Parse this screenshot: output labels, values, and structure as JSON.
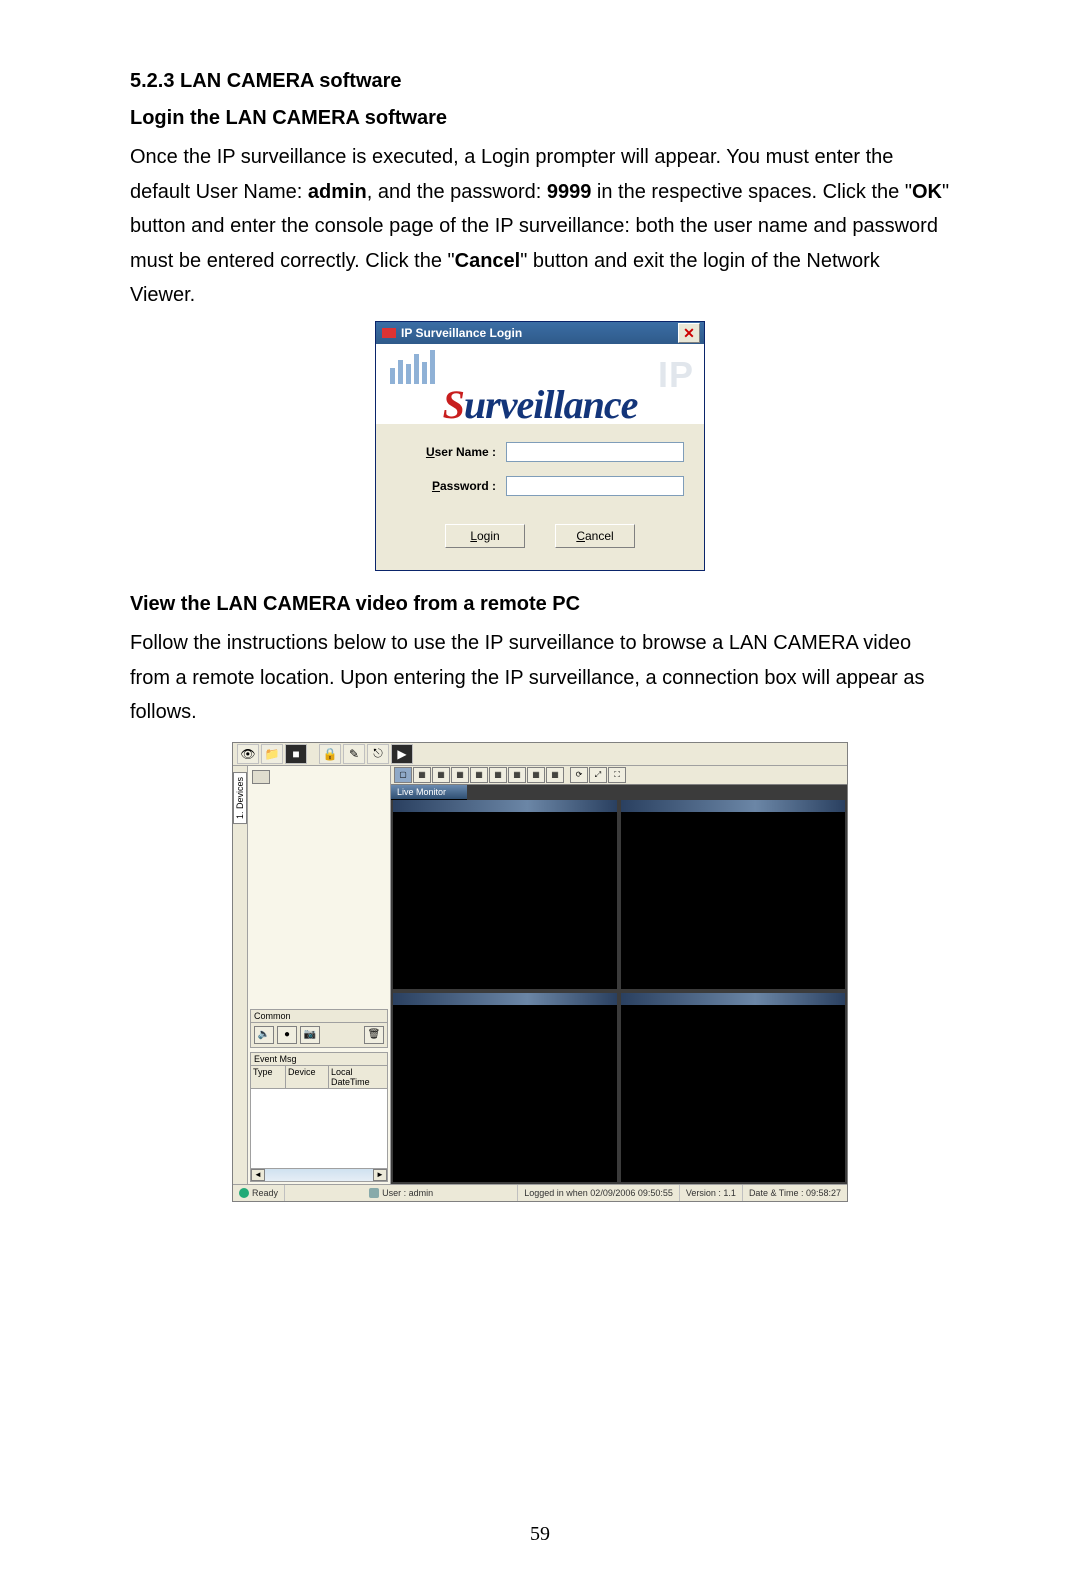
{
  "sections": {
    "heading_523": "5.2.3  LAN CAMERA software",
    "heading_login": "Login the LAN CAMERA software",
    "para1_a": "Once the IP surveillance is executed, a Login prompter will appear. You must enter the default User Name: ",
    "para1_b_bold": "admin",
    "para1_c": ", and the password: ",
    "para1_d_bold": "9999",
    "para1_e": " in the respective spaces. Click the \"",
    "para1_f_bold": "OK",
    "para1_g": "\" button and enter the console page of the IP surveillance: both the user name and password must be entered correctly. Click the \"",
    "para1_h_bold": "Cancel",
    "para1_i": "\" button and exit the login of the Network Viewer.",
    "heading_view": "View the LAN CAMERA video from a remote PC",
    "para2": "Follow the instructions below to use the IP surveillance to browse a LAN CAMERA video from a remote location. Upon entering the IP surveillance, a connection box will appear as follows."
  },
  "login_dialog": {
    "title": "IP Surveillance Login",
    "banner_red": "S",
    "banner_blue": "urveillance",
    "banner_ip": "IP",
    "user_label_ul": "U",
    "user_label_rest": "ser Name :",
    "pass_label_ul": "P",
    "pass_label_rest": "assword :",
    "login_btn_ul": "L",
    "login_btn_rest": "ogin",
    "cancel_btn_ul": "C",
    "cancel_btn_rest": "ancel"
  },
  "app": {
    "side_tab": "1. Devices",
    "common_title": "Common",
    "eventmsg_title": "Event Msg",
    "col_type": "Type",
    "col_device": "Device",
    "col_ldt": "Local DateTime",
    "live_tab": "Live Monitor",
    "status_ready": "Ready",
    "status_user": "User : admin",
    "status_logged": "Logged in when 02/09/2006 09:50:55",
    "status_version": "Version :  1.1",
    "status_datetime": "Date & Time :  09:58:27"
  },
  "page_number": "59"
}
